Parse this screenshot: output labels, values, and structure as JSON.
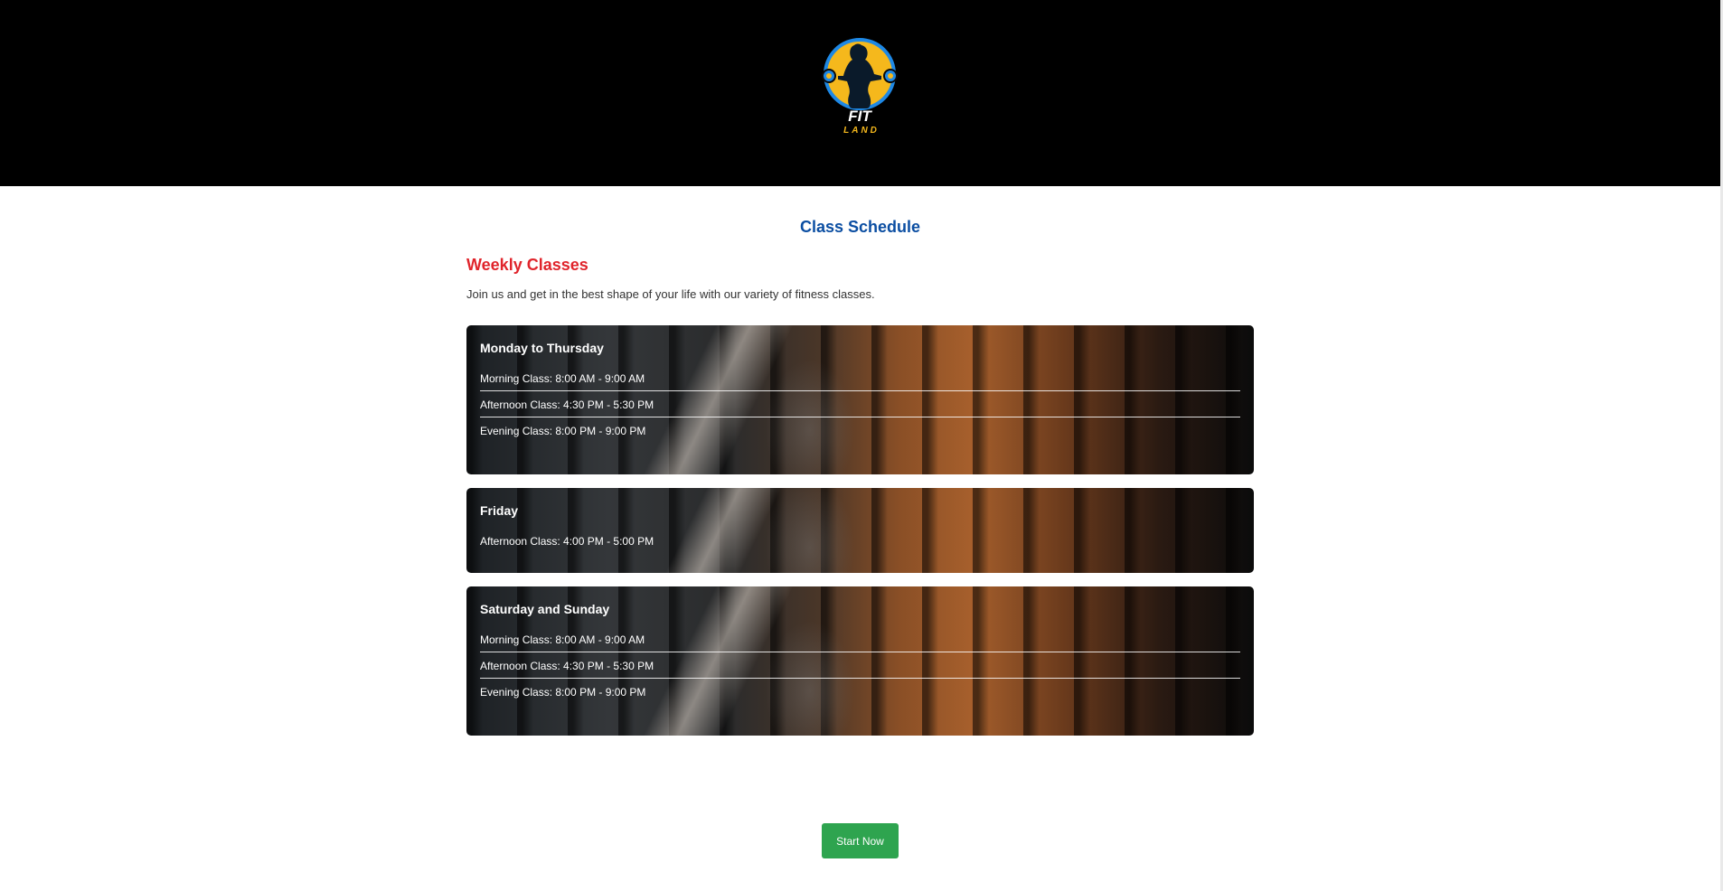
{
  "header": {
    "logo_text_top": "FIT",
    "logo_text_bottom": "LAND"
  },
  "main": {
    "page_title": "Class Schedule",
    "section_heading": "Weekly Classes",
    "intro": "Join us and get in the best shape of your life with our variety of fitness classes.",
    "cards": [
      {
        "title": "Monday to Thursday",
        "classes": [
          "Morning Class: 8:00 AM - 9:00 AM",
          "Afternoon Class: 4:30 PM - 5:30 PM",
          "Evening Class: 8:00 PM - 9:00 PM"
        ]
      },
      {
        "title": "Friday",
        "classes": [
          "Afternoon Class: 4:00 PM - 5:00 PM"
        ]
      },
      {
        "title": "Saturday and Sunday",
        "classes": [
          "Morning Class: 8:00 AM - 9:00 AM",
          "Afternoon Class: 4:30 PM - 5:30 PM",
          "Evening Class: 8:00 PM - 9:00 PM"
        ]
      }
    ]
  },
  "cta": {
    "start_label": "Start Now"
  },
  "colors": {
    "header_bg": "#000000",
    "title_blue": "#0b4ea2",
    "heading_red": "#e0242b",
    "button_green": "#2ea44f",
    "logo_yellow": "#f5b81c",
    "logo_blue": "#1e88e5"
  }
}
